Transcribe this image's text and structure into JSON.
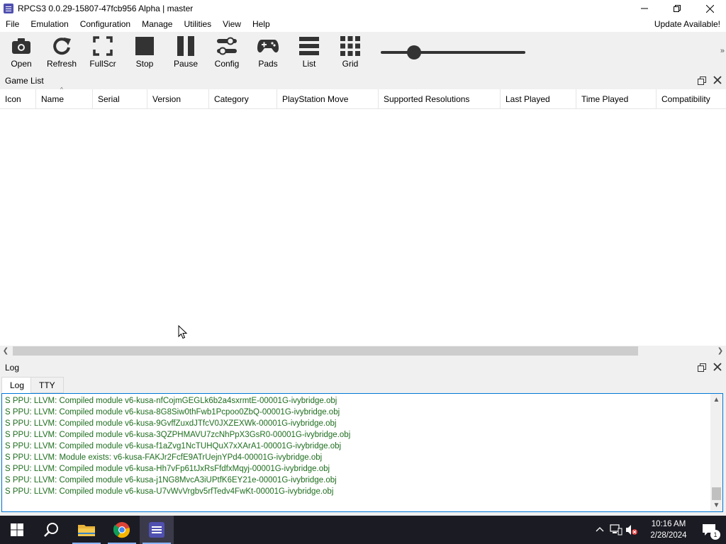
{
  "window": {
    "title": "RPCS3 0.0.29-15807-47fcb956 Alpha | master"
  },
  "menu": {
    "items": [
      "File",
      "Emulation",
      "Configuration",
      "Manage",
      "Utilities",
      "View",
      "Help"
    ],
    "update_notice": "Update Available!"
  },
  "toolbar": {
    "buttons": [
      {
        "label": "Open",
        "icon": "camera-icon"
      },
      {
        "label": "Refresh",
        "icon": "refresh-icon"
      },
      {
        "label": "FullScr",
        "icon": "fullscreen-icon"
      },
      {
        "label": "Stop",
        "icon": "stop-icon"
      },
      {
        "label": "Pause",
        "icon": "pause-icon"
      },
      {
        "label": "Config",
        "icon": "config-icon"
      },
      {
        "label": "Pads",
        "icon": "gamepad-icon"
      },
      {
        "label": "List",
        "icon": "list-icon"
      },
      {
        "label": "Grid",
        "icon": "grid-icon"
      }
    ],
    "icon_size_slider": 0.23
  },
  "game_list": {
    "title": "Game List",
    "columns": [
      "Icon",
      "Name",
      "Serial",
      "Version",
      "Category",
      "PlayStation Move",
      "Supported Resolutions",
      "Last Played",
      "Time Played",
      "Compatibility"
    ],
    "rows": []
  },
  "log_panel": {
    "title": "Log",
    "tabs": [
      "Log",
      "TTY"
    ],
    "active_tab": "Log",
    "lines": [
      "S PPU: LLVM: Compiled module v6-kusa-nfCojmGEGLk6b2a4sxrmtE-00001G-ivybridge.obj",
      "S PPU: LLVM: Compiled module v6-kusa-8G8Siw0thFwb1Pcpoo0ZbQ-00001G-ivybridge.obj",
      "S PPU: LLVM: Compiled module v6-kusa-9GvffZuxdJTfcV0JXZEXWk-00001G-ivybridge.obj",
      "S PPU: LLVM: Compiled module v6-kusa-3QZPHMAVU7zcNhPpX3GsR0-00001G-ivybridge.obj",
      "S PPU: LLVM: Compiled module v6-kusa-f1aZvg1NcTUHQuX7xXArA1-00001G-ivybridge.obj",
      "S PPU: LLVM: Module exists: v6-kusa-FAKJr2FcfE9ATrUejnYPd4-00001G-ivybridge.obj",
      "S PPU: LLVM: Compiled module v6-kusa-Hh7vFp61tJxRsFfdfxMqyj-00001G-ivybridge.obj",
      "S PPU: LLVM: Compiled module v6-kusa-j1NG8MvcA3iUPtfK6EY21e-00001G-ivybridge.obj",
      "S PPU: LLVM: Compiled module v6-kusa-U7vWvVrgbv5rfTedv4FwKt-00001G-ivybridge.obj"
    ],
    "text_color": "#1e6e1e"
  },
  "taskbar": {
    "apps": [
      "start-icon",
      "search-icon",
      "file-explorer-icon",
      "chrome-icon",
      "rpcs3-icon"
    ],
    "active_app": "rpcs3-icon",
    "clock_time": "10:16 AM",
    "clock_date": "2/28/2024",
    "notification_count": "1"
  },
  "colors": {
    "accent": "#0078d7",
    "taskbar_bg": "#1b1b24",
    "icon_dark": "#333333"
  }
}
